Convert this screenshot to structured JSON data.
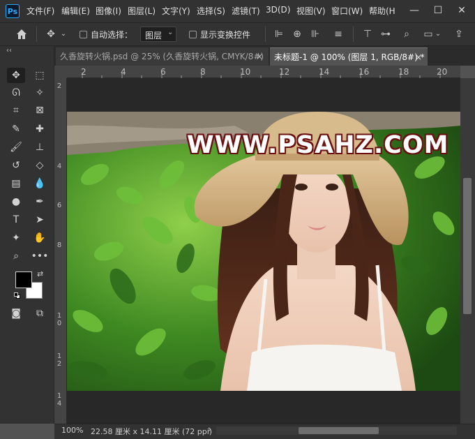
{
  "app": {
    "logo": "Ps",
    "menu": [
      "文件(F)",
      "编辑(E)",
      "图像(I)",
      "图层(L)",
      "文字(Y)",
      "选择(S)",
      "滤镜(T)",
      "3D(D)",
      "视图(V)",
      "窗口(W)",
      "帮助(H"
    ],
    "window_controls": {
      "minimize": "—",
      "maximize": "☐",
      "close": "✕"
    }
  },
  "options_bar": {
    "auto_select_label": "自动选择：",
    "auto_select_target": "图层",
    "show_transform_label": "显示变换控件"
  },
  "tabs": [
    {
      "label": "久香旋转火锅.psd @ 25% (久香旋转火锅, CMYK/8#)",
      "close": "×",
      "active": false
    },
    {
      "label": "未标题-1 @ 100% (图层 1, RGB/8#) *",
      "close": "×",
      "active": true
    }
  ],
  "toolbar": {
    "collapse": "‹‹"
  },
  "rulers": {
    "horizontal": [
      "2",
      "4",
      "6",
      "8",
      "10",
      "12",
      "14",
      "16",
      "18",
      "20"
    ],
    "vertical": [
      "2",
      "4",
      "6",
      "8",
      "10",
      "12",
      "14"
    ]
  },
  "canvas": {
    "watermark": "WWW.PSAHZ.COM"
  },
  "status": {
    "zoom": "100%",
    "doc_size": "22.58 厘米 x 14.11 厘米 (72 ppi)",
    "arrow": "›"
  },
  "colors": {
    "foreground": "#000000",
    "background": "#ffffff",
    "accent": "#31a8ff"
  }
}
